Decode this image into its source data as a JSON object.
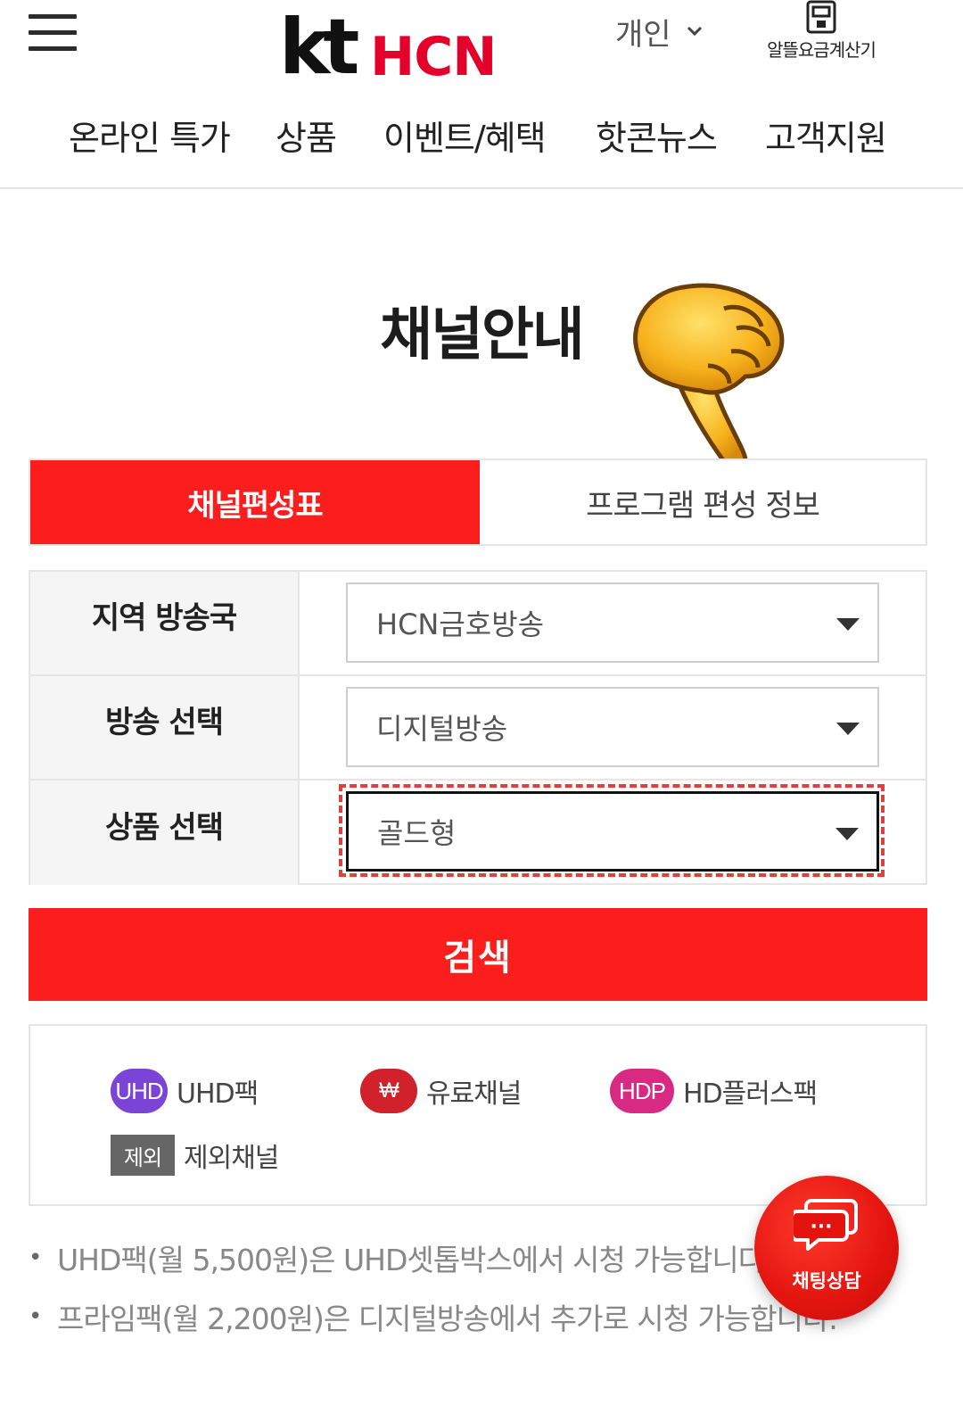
{
  "header": {
    "brand_kt": "kt",
    "brand_hcn": "HCN",
    "personal_label": "개인",
    "calculator_label": "알뜰요금계산기"
  },
  "nav": {
    "items": [
      {
        "label": "온라인 특가"
      },
      {
        "label": "상품"
      },
      {
        "label": "이벤트/혜택"
      },
      {
        "label": "핫콘뉴스"
      },
      {
        "label": "고객지원"
      }
    ]
  },
  "page": {
    "title": "채널안내"
  },
  "tabs": [
    {
      "label": "채널편성표",
      "active": true
    },
    {
      "label": "프로그램 편성 정보",
      "active": false
    }
  ],
  "form": {
    "rows": [
      {
        "label": "지역 방송국",
        "value": "HCN금호방송"
      },
      {
        "label": "방송 선택",
        "value": "디지털방송"
      },
      {
        "label": "상품 선택",
        "value": "골드형"
      }
    ]
  },
  "search": {
    "label": "검색"
  },
  "legend": {
    "items": [
      {
        "tag": "UHD",
        "label": "UHD팩",
        "color": "#7b44d6"
      },
      {
        "tag": "₩",
        "label": "유료채널",
        "color": "#d1212a"
      },
      {
        "tag": "HDP",
        "label": "HD플러스팩",
        "color": "#d82a82"
      },
      {
        "tag": "제외",
        "label": "제외채널",
        "color": "#666666"
      }
    ]
  },
  "notes": [
    "UHD팩(월 5,500원)은 UHD셋톱박스에서 시청 가능합니다.",
    "프라임팩(월 2,200원)은 디지털방송에서 추가로 시청 가능합니다."
  ],
  "chat": {
    "label": "채팅상담",
    "bubble": "···"
  },
  "colors": {
    "primary": "#fc1d1d",
    "brand_red": "#e4002b"
  },
  "icons": [
    "hamburger-menu-icon",
    "chevron-down-icon",
    "calculator-icon",
    "dropdown-caret-icon",
    "chat-bubble-icon",
    "pointing-hand-icon"
  ]
}
